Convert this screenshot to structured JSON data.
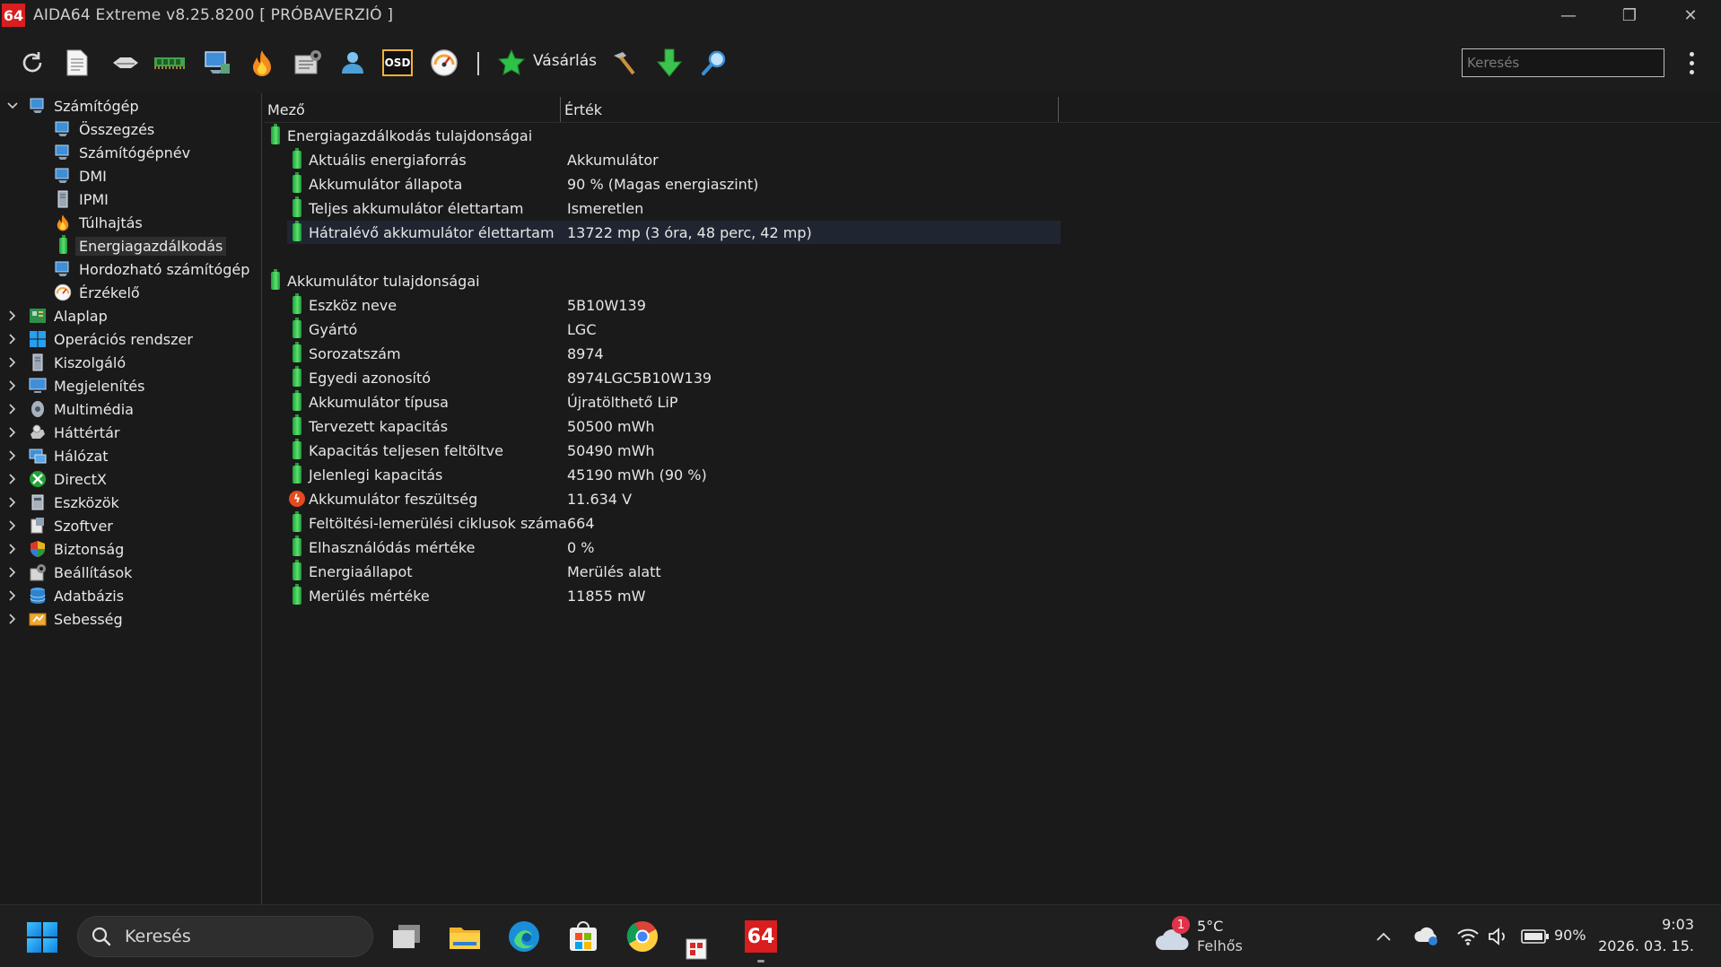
{
  "window": {
    "logo": "64",
    "title": "AIDA64 Extreme v8.25.8200  [ PRÓBAVERZIÓ ]",
    "minimize_glyph": "—",
    "restore_glyph": "❐",
    "close_glyph": "✕"
  },
  "toolbar": {
    "buy_label": "Vásárlás",
    "search_placeholder": "Keresés",
    "osd_label": "OSD"
  },
  "tree": {
    "root": {
      "label": "Számítógép",
      "expanded": true
    },
    "children": [
      {
        "label": "Összegzés",
        "icon": "computer-icon"
      },
      {
        "label": "Számítógépnév",
        "icon": "computer-icon"
      },
      {
        "label": "DMI",
        "icon": "computer-icon"
      },
      {
        "label": "IPMI",
        "icon": "server-icon"
      },
      {
        "label": "Túlhajtás",
        "icon": "flame-icon"
      },
      {
        "label": "Energiagazdálkodás",
        "icon": "battery-icon",
        "selected": true
      },
      {
        "label": "Hordozható számítógép",
        "icon": "computer-icon"
      },
      {
        "label": "Érzékelő",
        "icon": "gauge-icon"
      }
    ],
    "groups": [
      {
        "label": "Alaplap",
        "icon": "motherboard-icon"
      },
      {
        "label": "Operációs rendszer",
        "icon": "windows-icon"
      },
      {
        "label": "Kiszolgáló",
        "icon": "server-icon"
      },
      {
        "label": "Megjelenítés",
        "icon": "monitor-icon"
      },
      {
        "label": "Multimédia",
        "icon": "speaker-icon"
      },
      {
        "label": "Háttértár",
        "icon": "disk-icon"
      },
      {
        "label": "Hálózat",
        "icon": "network-icon"
      },
      {
        "label": "DirectX",
        "icon": "xbox-icon"
      },
      {
        "label": "Eszközök",
        "icon": "devices-icon"
      },
      {
        "label": "Szoftver",
        "icon": "software-icon"
      },
      {
        "label": "Biztonság",
        "icon": "shield-icon"
      },
      {
        "label": "Beállítások",
        "icon": "settings-icon"
      },
      {
        "label": "Adatbázis",
        "icon": "database-icon"
      },
      {
        "label": "Sebesség",
        "icon": "benchmark-icon"
      }
    ]
  },
  "detail": {
    "columns": {
      "field": "Mező",
      "value": "Érték"
    },
    "section1": {
      "title": "Energiagazdálkodás tulajdonságai",
      "rows": [
        {
          "field": "Aktuális energiaforrás",
          "value": "Akkumulátor"
        },
        {
          "field": "Akkumulátor állapota",
          "value": "90 % (Magas energiaszint)"
        },
        {
          "field": "Teljes akkumulátor élettartam",
          "value": "Ismeretlen"
        },
        {
          "field": "Hátralévő akkumulátor élettartam",
          "value": "13722 mp (3 óra, 48 perc, 42 mp)"
        }
      ]
    },
    "section2": {
      "title": "Akkumulátor tulajdonságai",
      "rows": [
        {
          "field": "Eszköz neve",
          "value": "5B10W139"
        },
        {
          "field": "Gyártó",
          "value": "LGC"
        },
        {
          "field": "Sorozatszám",
          "value": "8974"
        },
        {
          "field": "Egyedi azonosító",
          "value": "8974LGC5B10W139"
        },
        {
          "field": "Akkumulátor típusa",
          "value": "Újratölthető LiP"
        },
        {
          "field": "Tervezett kapacitás",
          "value": "50500 mWh"
        },
        {
          "field": "Kapacitás teljesen feltöltve",
          "value": "50490 mWh"
        },
        {
          "field": "Jelenlegi kapacitás",
          "value": "45190 mWh  (90 %)"
        },
        {
          "field": "Akkumulátor feszültség",
          "value": "11.634 V"
        },
        {
          "field": "Feltöltési-lemerülési ciklusok száma",
          "value": "664"
        },
        {
          "field": "Elhasználódás mértéke",
          "value": "0 %"
        },
        {
          "field": "Energiaállapot",
          "value": "Merülés alatt"
        },
        {
          "field": "Merülés mértéke",
          "value": "11855 mW"
        }
      ]
    }
  },
  "taskbar": {
    "search_label": "Keresés",
    "app_logo": "64",
    "weather": {
      "badge": "1",
      "temp": "5°C",
      "desc": "Felhős"
    },
    "battery_percent": "90%",
    "time": "9:03",
    "date": "2026. 03. 15."
  },
  "colors": {
    "accent_battery": "#3cc34f",
    "aida_red": "#d81e1e",
    "selected_row": "#1f2632"
  }
}
